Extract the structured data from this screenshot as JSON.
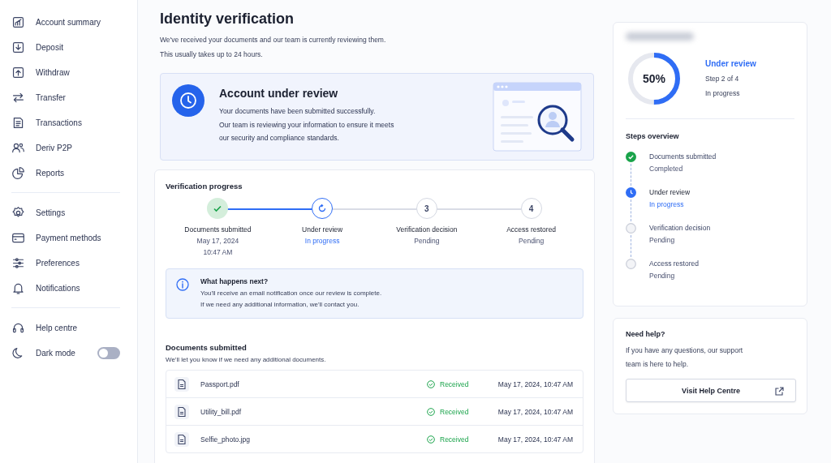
{
  "sidebar": {
    "groups": [
      [
        {
          "label": "Account summary"
        },
        {
          "label": "Deposit"
        },
        {
          "label": "Withdraw"
        },
        {
          "label": "Transfer"
        },
        {
          "label": "Transactions"
        },
        {
          "label": "Deriv P2P"
        },
        {
          "label": "Reports"
        }
      ],
      [
        {
          "label": "Settings"
        },
        {
          "label": "Payment methods"
        },
        {
          "label": "Preferences"
        },
        {
          "label": "Notifications"
        }
      ],
      [
        {
          "label": "Help centre"
        },
        {
          "label": "Dark mode",
          "kind": "toggle",
          "on": false
        }
      ]
    ]
  },
  "header": {
    "title": "Identity verification",
    "subtitle": [
      "We've received your documents and our team is currently reviewing them.",
      "This usually takes up to 24 hours."
    ]
  },
  "banner": {
    "title": "Account under review",
    "lines": [
      "Your documents have been submitted successfully.",
      "Our team is reviewing your information to ensure it meets",
      "our security and compliance standards."
    ]
  },
  "progress": {
    "title": "Verification progress",
    "steps": [
      {
        "kind": "done",
        "label": "Documents submitted",
        "details": [
          "May 17, 2024",
          "10:47 AM"
        ]
      },
      {
        "kind": "current",
        "label": "Under review",
        "details": [
          "In progress"
        ]
      },
      {
        "kind": "pending",
        "number": "3",
        "label": "Verification decision",
        "details": [
          "Pending"
        ]
      },
      {
        "kind": "pending",
        "number": "4",
        "label": "Access restored",
        "details": [
          "Pending"
        ]
      }
    ]
  },
  "next": {
    "title": "What happens next?",
    "lines": [
      "You'll receive an email notification once our review is complete.",
      "If we need any additional information, we'll contact you."
    ]
  },
  "documents": {
    "title": "Documents submitted",
    "subtitle": "We'll let you know if we need any additional documents.",
    "rows": [
      {
        "name": "Passport.pdf",
        "status": "Received",
        "date": "May 17, 2024, 10:47 AM"
      },
      {
        "name": "Utility_bill.pdf",
        "status": "Received",
        "date": "May 17, 2024, 10:47 AM"
      },
      {
        "name": "Selfie_photo.jpg",
        "status": "Received",
        "date": "May 17, 2024, 10:47 AM"
      }
    ]
  },
  "status_card": {
    "percent": "50%",
    "state": "Under review",
    "step": "Step 2 of 4",
    "detail": "In progress",
    "overview_title": "Steps overview",
    "steps": [
      {
        "kind": "done",
        "label": "Documents submitted",
        "detail": "Completed"
      },
      {
        "kind": "current",
        "label": "Under review",
        "detail": "In progress"
      },
      {
        "kind": "pending",
        "label": "Verification decision",
        "detail": "Pending"
      },
      {
        "kind": "pending",
        "label": "Access restored",
        "detail": "Pending"
      }
    ]
  },
  "help": {
    "title": "Need help?",
    "text": "If you have any questions, our support team is here to help.",
    "button": "Visit Help Centre"
  }
}
